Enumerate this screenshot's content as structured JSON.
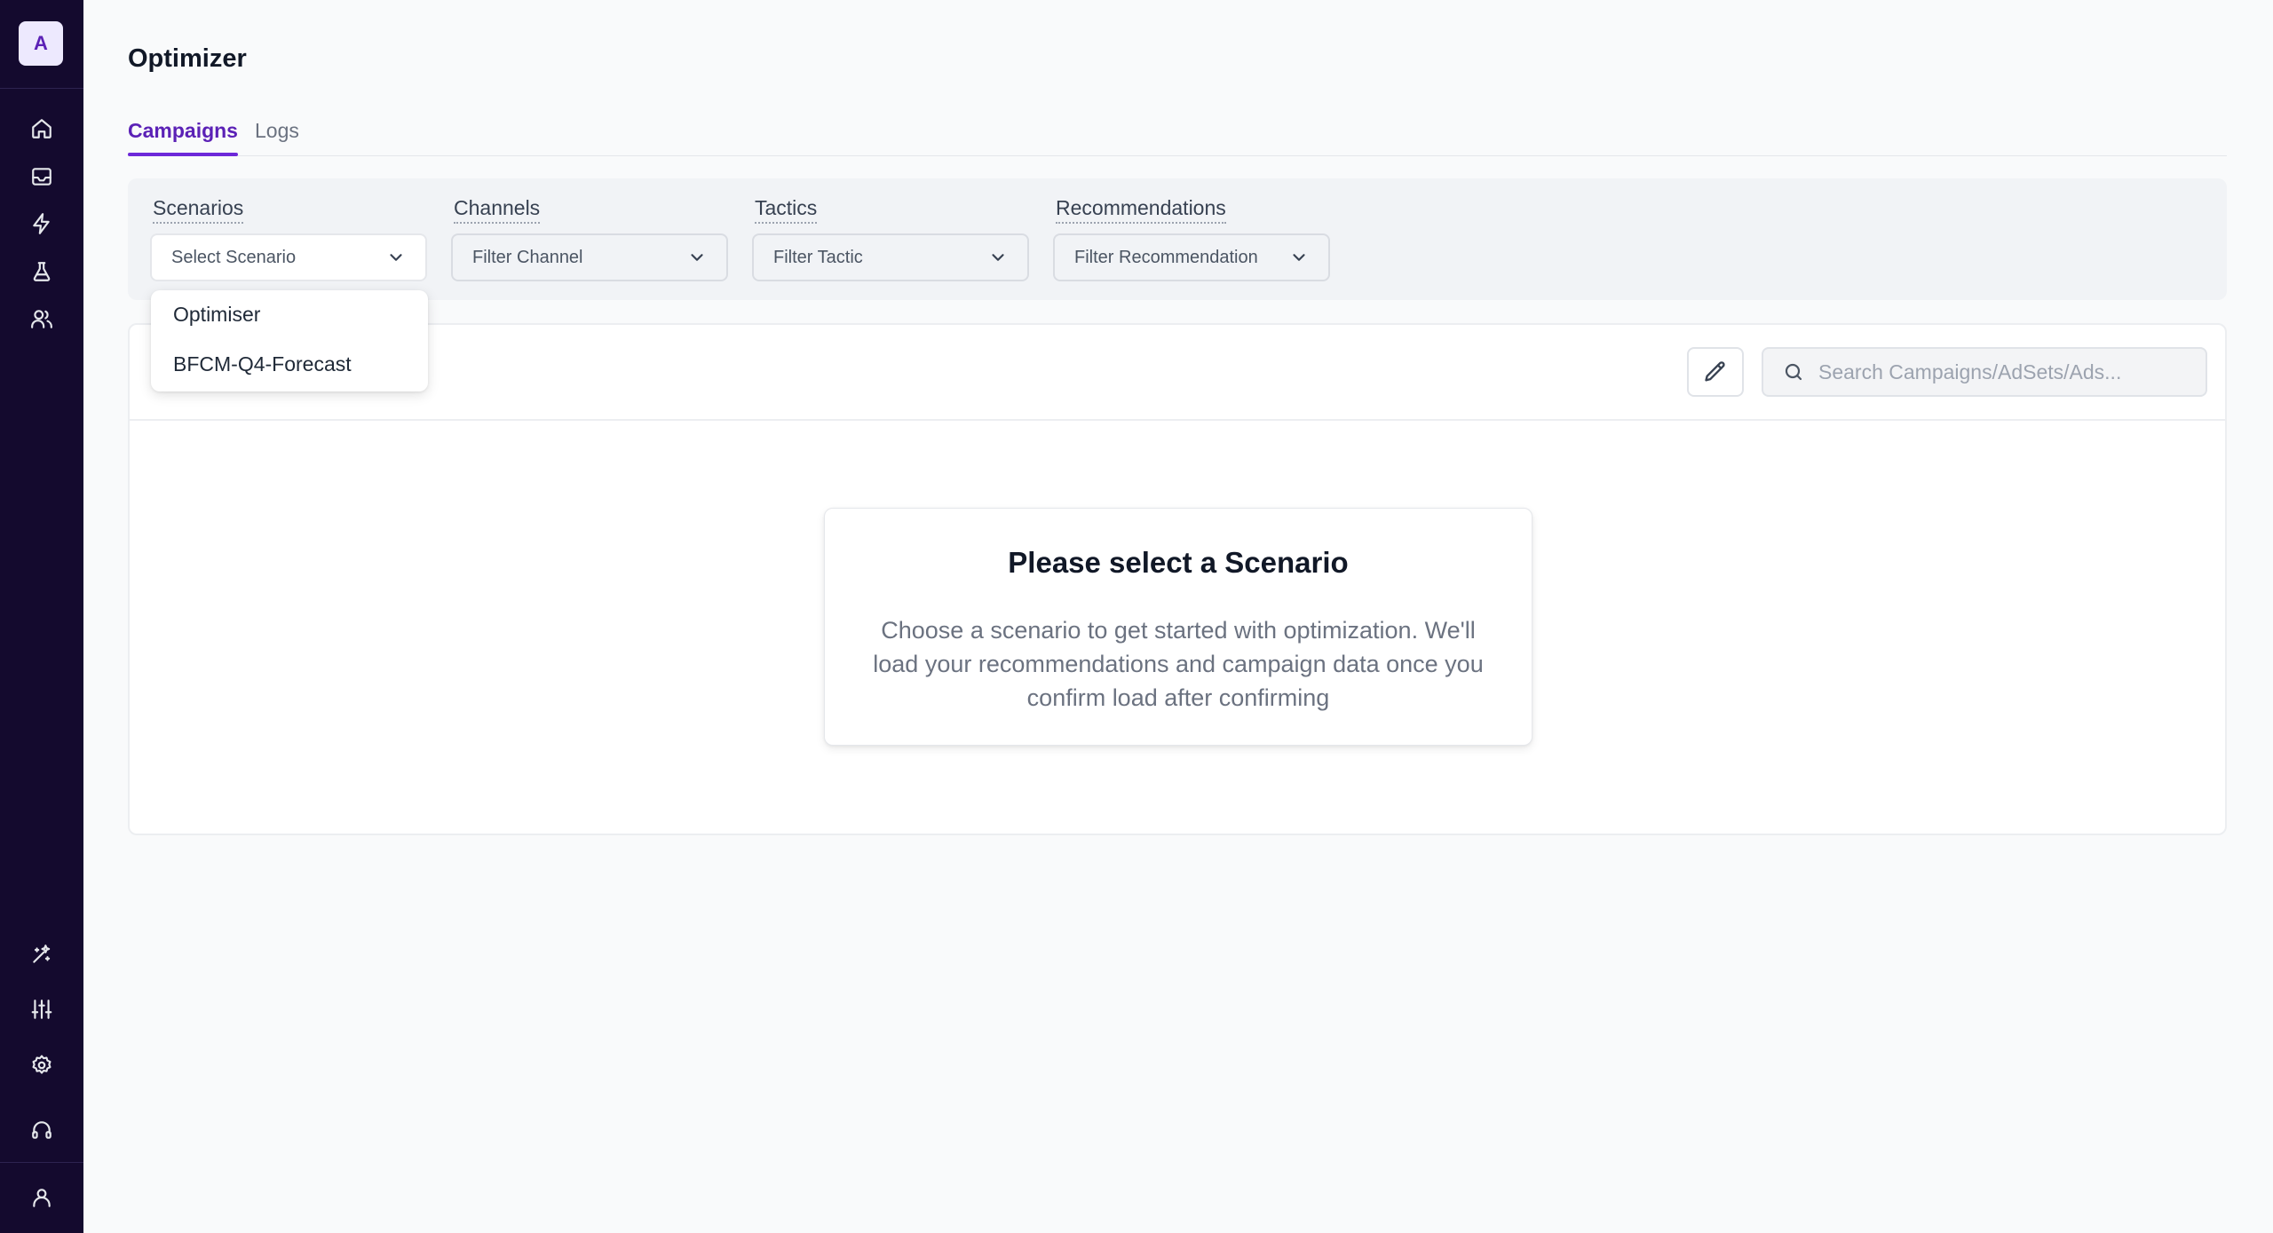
{
  "sidebar": {
    "avatar_letter": "A",
    "top_icons": [
      "home-icon",
      "inbox-icon",
      "zap-icon",
      "flask-icon",
      "users-icon"
    ],
    "bottom_icons": [
      "sparkle-icon",
      "sliders-icon",
      "settings-icon",
      "headset-icon",
      "user-icon"
    ]
  },
  "header": {
    "title": "Optimizer"
  },
  "tabs": [
    {
      "label": "Campaigns",
      "active": true
    },
    {
      "label": "Logs",
      "active": false
    }
  ],
  "filters": {
    "scenarios": {
      "label": "Scenarios",
      "value": "Select Scenario"
    },
    "channels": {
      "label": "Channels",
      "value": "Filter Channel"
    },
    "tactics": {
      "label": "Tactics",
      "value": "Filter Tactic"
    },
    "recommendations": {
      "label": "Recommendations",
      "value": "Filter Recommendation"
    }
  },
  "scenario_dropdown": {
    "options": [
      "Optimiser",
      "BFCM-Q4-Forecast"
    ]
  },
  "toolbar": {
    "search_placeholder": "Search Campaigns/AdSets/Ads..."
  },
  "empty_state": {
    "title": "Please select a Scenario",
    "message": "Choose a scenario to get started with optimization. We'll load your recommendations and campaign data once you confirm load after confirming"
  },
  "colors": {
    "sidebar_bg": "#140a2e",
    "accent": "#6d28d9",
    "page_bg": "#f9fafb"
  }
}
